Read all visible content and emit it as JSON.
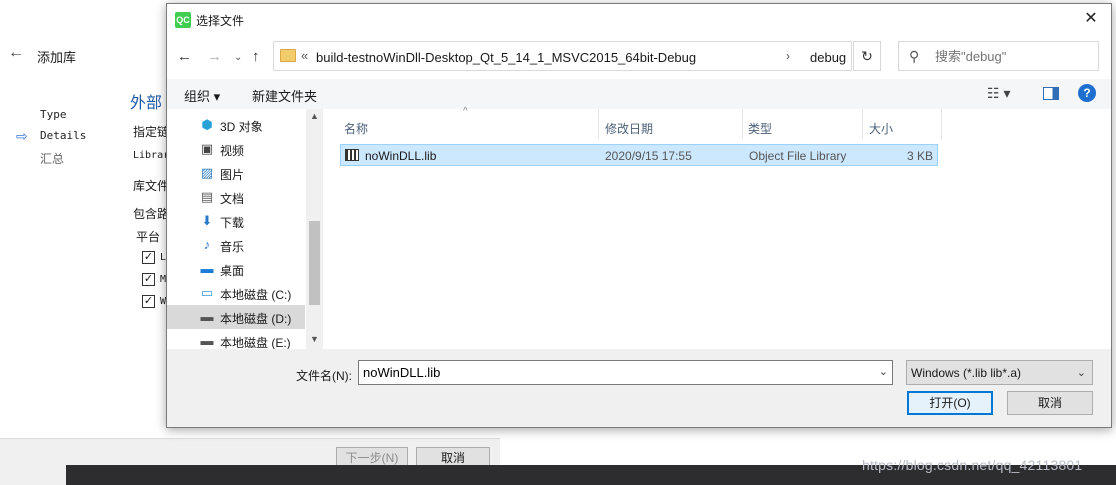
{
  "background_wizard": {
    "back_icon": "←",
    "title": "添加库",
    "steps": [
      "Type",
      "Details",
      "汇总"
    ],
    "heading": "外部",
    "labels": [
      "指定链",
      "Librar",
      "库文件",
      "包含路",
      "平台"
    ],
    "checkbox_labels": [
      "L",
      "M",
      "W"
    ],
    "next_label": "下一步(N)",
    "cancel_label": "取消"
  },
  "watermark": "https://blog.csdn.net/qq_42113801",
  "dialog": {
    "logo": "QC",
    "title": "选择文件",
    "close_icon": "✕",
    "nav": {
      "back_icon": "←",
      "forward_icon": "→",
      "recent_icon": "⌄",
      "up_icon": "↑"
    },
    "address": {
      "chevron": "«",
      "path1": "build-testnoWinDll-Desktop_Qt_5_14_1_MSVC2015_64bit-Debug",
      "separator": "›",
      "path2": "debug"
    },
    "refresh_icon": "↻",
    "search": {
      "icon": "⚲",
      "placeholder": "搜索\"debug\""
    },
    "toolbar": {
      "organize": "组织 ▾",
      "new_folder": "新建文件夹",
      "view_icon": "☷ ▾",
      "help_icon": "?"
    },
    "nav_items": [
      {
        "label": "3D 对象",
        "icon": "cube-icon",
        "glyph": "⬢",
        "color": "#29a3d6"
      },
      {
        "label": "视频",
        "icon": "video-icon",
        "glyph": "▣",
        "color": "#444444"
      },
      {
        "label": "图片",
        "icon": "picture-icon",
        "glyph": "▨",
        "color": "#2f7fc1"
      },
      {
        "label": "文档",
        "icon": "document-icon",
        "glyph": "▤",
        "color": "#5c5c5c"
      },
      {
        "label": "下载",
        "icon": "download-icon",
        "glyph": "⬇",
        "color": "#2a78c8"
      },
      {
        "label": "音乐",
        "icon": "music-icon",
        "glyph": "♪",
        "color": "#2a78c8"
      },
      {
        "label": "桌面",
        "icon": "desktop-icon",
        "glyph": "▬",
        "color": "#1b7bd6"
      },
      {
        "label": "本地磁盘 (C:)",
        "icon": "drive-c-icon",
        "glyph": "▭",
        "color": "#3a9ad9"
      },
      {
        "label": "本地磁盘 (D:)",
        "icon": "drive-d-icon",
        "glyph": "▬",
        "color": "#555555"
      },
      {
        "label": "本地磁盘 (E:)",
        "icon": "drive-e-icon",
        "glyph": "▬",
        "color": "#555555"
      }
    ],
    "selected_nav_index": 8,
    "scroll": {
      "up": "▲",
      "down": "▼"
    },
    "columns": {
      "name": "名称",
      "modified": "修改日期",
      "type": "类型",
      "size": "大小",
      "sort_icon": "^"
    },
    "files": [
      {
        "name": "noWinDLL.lib",
        "modified": "2020/9/15 17:55",
        "type": "Object File Library",
        "size": "3 KB"
      }
    ],
    "filename_label": "文件名(N):",
    "filename_value": "noWinDLL.lib",
    "filename_chevron": "⌄",
    "filter_value": "Windows (*.lib lib*.a)",
    "filter_chevron": "⌄",
    "open_label": "打开(O)",
    "cancel_label": "取消"
  }
}
